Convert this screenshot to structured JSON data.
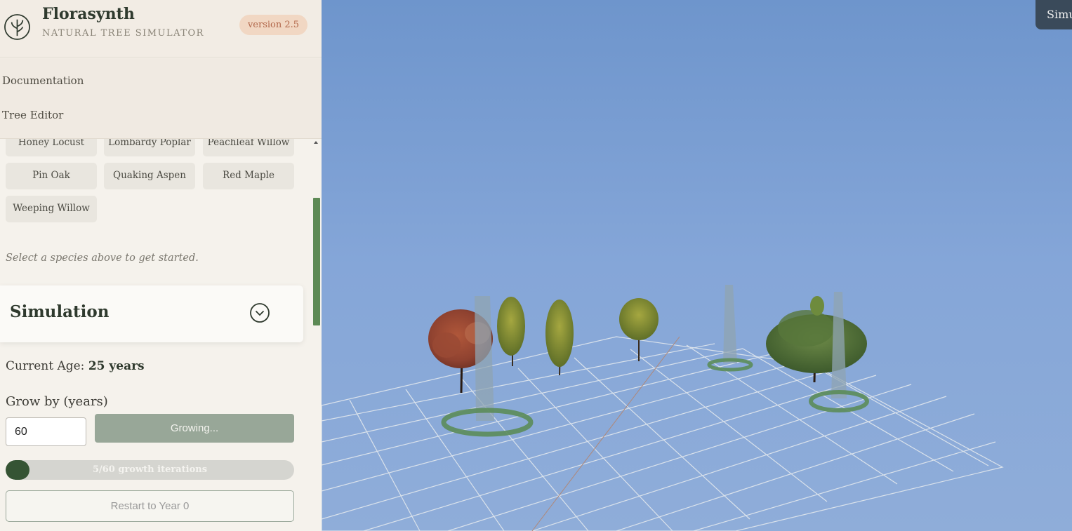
{
  "header": {
    "title": "Florasynth",
    "subtitle": "NATURAL TREE SIMULATOR",
    "version": "version 2.5"
  },
  "nav": {
    "items": [
      {
        "label": "Documentation"
      },
      {
        "label": "Tree Editor"
      }
    ]
  },
  "species": {
    "items": [
      {
        "label": "Honey Locust"
      },
      {
        "label": "Lombardy Poplar"
      },
      {
        "label": "Peachleaf Willow"
      },
      {
        "label": "Pin Oak"
      },
      {
        "label": "Quaking Aspen"
      },
      {
        "label": "Red Maple"
      },
      {
        "label": "Weeping Willow"
      }
    ],
    "hint": "Select a species above to get started."
  },
  "simulation": {
    "title": "Simulation",
    "current_age_label": "Current Age:",
    "current_age_value": "25 years",
    "grow_label": "Grow by (years)",
    "grow_value": "60",
    "grow_button": "Growing...",
    "progress_text": "5/60 growth iterations",
    "progress_fraction": 0.0833,
    "restart_button": "Restart to Year 0"
  },
  "viewport": {
    "tab_label": "Simu"
  },
  "colors": {
    "accent": "#355434",
    "sky_top": "#6f96cd",
    "sky_bottom": "#8eabd8",
    "version_bg": "#f1d7c3",
    "version_text": "#b2674a"
  },
  "icons": {
    "logo": "tree-logo-icon",
    "toggle": "chevron-down-circle-icon"
  }
}
